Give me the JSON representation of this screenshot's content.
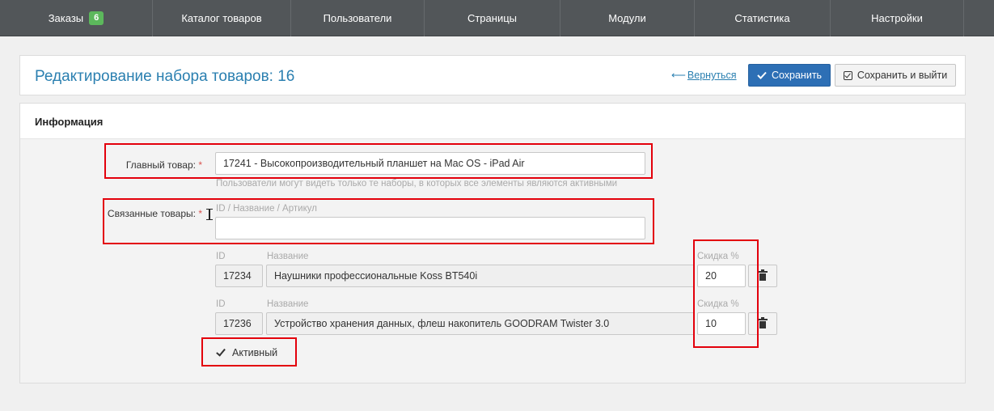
{
  "nav": {
    "items": [
      {
        "label": "Заказы",
        "badge": "6"
      },
      {
        "label": "Каталог товаров"
      },
      {
        "label": "Пользователи"
      },
      {
        "label": "Страницы"
      },
      {
        "label": "Модули"
      },
      {
        "label": "Статистика"
      },
      {
        "label": "Настройки"
      }
    ]
  },
  "header": {
    "title": "Редактирование набора товаров: 16",
    "back_arrow": "⟵",
    "back_label": "Вернуться",
    "save_label": "Сохранить",
    "save_exit_label": "Сохранить и выйти"
  },
  "section": {
    "title": "Информация"
  },
  "form": {
    "main_product_label": "Главный товар:",
    "required_mark": "*",
    "main_product_value": "17241 - Высокопроизводительный планшет на Mac OS - iPad Air",
    "visibility_hint": "Пользователи могут видеть только те наборы, в которых все элементы являются активными",
    "related_label": "Связанные товары:",
    "related_search_hint": "ID / Название / Артикул",
    "related_search_value": "",
    "columns": {
      "id": "ID",
      "name": "Название",
      "discount": "Скидка %"
    },
    "related_items": [
      {
        "id": "17234",
        "name": "Наушники профессиональные Koss BT540i",
        "discount": "20"
      },
      {
        "id": "17236",
        "name": "Устройство хранения данных, флеш накопитель GOODRAM Twister 3.0",
        "discount": "10"
      }
    ],
    "active_label": "Активный",
    "active_checked": true
  },
  "colors": {
    "nav_bg": "#525659",
    "accent": "#2a7fb0",
    "primary_button": "#2d6fb5",
    "badge": "#5cb85c",
    "highlight": "#e3000b"
  },
  "icons": {
    "save": "checkmark-icon",
    "save_exit": "checkbox-icon",
    "delete": "trash-icon",
    "back": "arrow-left-icon"
  }
}
